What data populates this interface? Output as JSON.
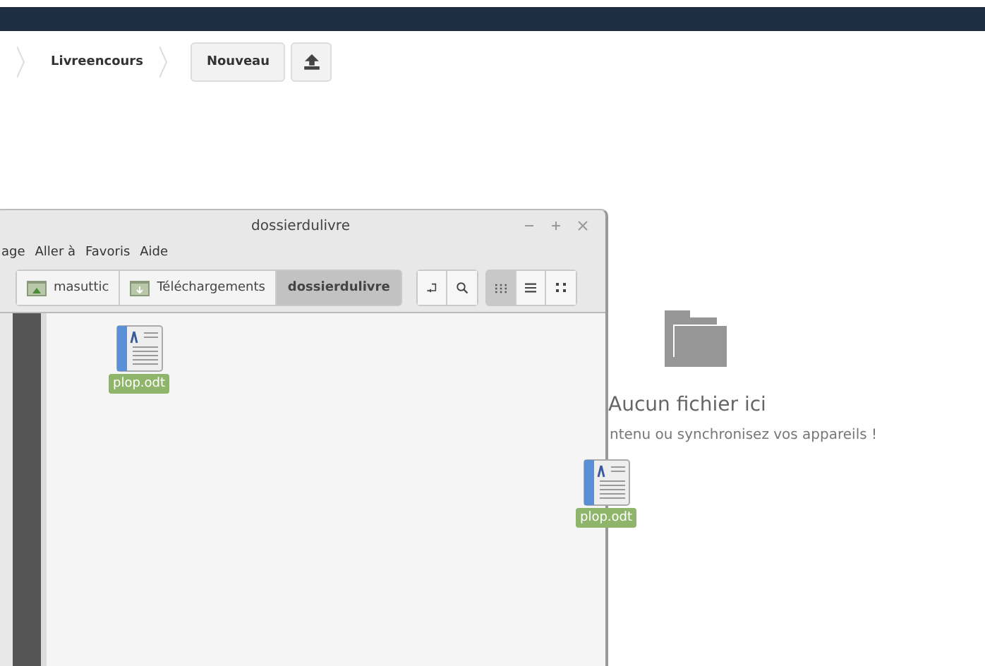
{
  "breadcrumb": {
    "items": [
      {
        "label": "Livreencours"
      }
    ],
    "new_button": "Nouveau"
  },
  "empty_state": {
    "title": "Aucun fichier ici",
    "subtitle": "ntenu ou synchronisez vos appareils !"
  },
  "dragged_file": {
    "name": "plop.odt"
  },
  "window": {
    "title": "dossierdulivre",
    "menu": [
      "age",
      "Aller à",
      "Favoris",
      "Aide"
    ],
    "path": [
      {
        "label": "masuttic",
        "kind": "home",
        "selected": false
      },
      {
        "label": "Téléchargements",
        "kind": "download",
        "selected": false
      },
      {
        "label": "dossierdulivre",
        "kind": "plain",
        "selected": true
      }
    ],
    "views": [
      {
        "kind": "icons",
        "selected": true
      },
      {
        "kind": "list",
        "selected": false
      },
      {
        "kind": "compact",
        "selected": false
      }
    ],
    "files": [
      {
        "name": "plop.odt",
        "selected": true
      }
    ]
  }
}
